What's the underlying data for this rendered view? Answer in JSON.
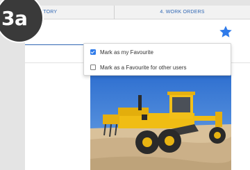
{
  "tabs": {
    "history_label": "HISTORY",
    "work_orders_label": "4. WORK ORDERS"
  },
  "badge": {
    "label": "3a"
  },
  "menu": {
    "items": [
      {
        "label": "Mark as my Favourite",
        "checked": true
      },
      {
        "label": "Mark as a Favourite for other users",
        "checked": false
      }
    ]
  },
  "icons": {
    "favourite": "star-icon"
  },
  "colors": {
    "accent": "#2f66b3",
    "star": "#2f7bea",
    "checkbox": "#2f7bea"
  }
}
